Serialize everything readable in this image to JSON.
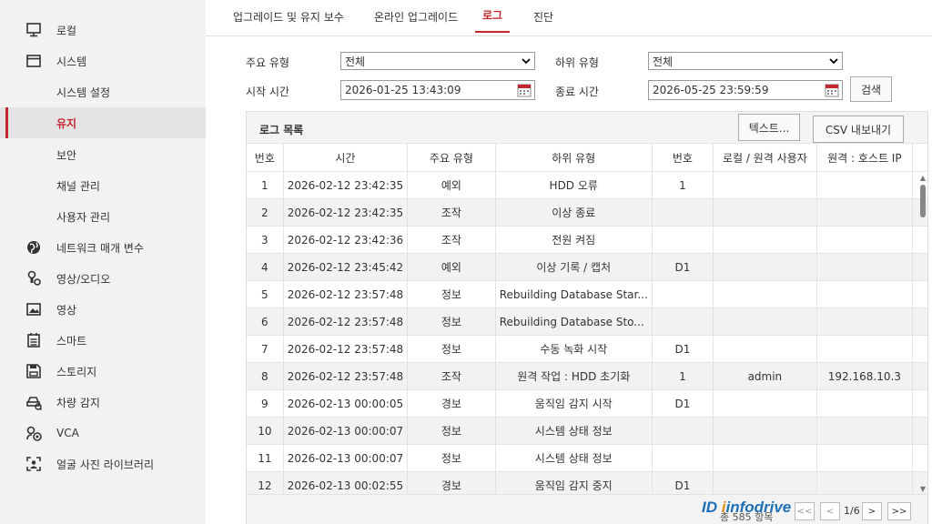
{
  "sidebar": {
    "items": [
      {
        "label": "로컬",
        "icon": "monitor-icon"
      },
      {
        "label": "시스템",
        "icon": "window-icon"
      },
      {
        "label": "시스템 설정"
      },
      {
        "label": "유지"
      },
      {
        "label": "보안"
      },
      {
        "label": "채널 관리"
      },
      {
        "label": "사용자 관리"
      },
      {
        "label": "네트워크 매개 변수",
        "icon": "globe-icon"
      },
      {
        "label": "영상/오디오",
        "icon": "video-audio-icon"
      },
      {
        "label": "영상",
        "icon": "image-icon"
      },
      {
        "label": "스마트",
        "icon": "smart-icon"
      },
      {
        "label": "스토리지",
        "icon": "storage-icon"
      },
      {
        "label": "차량 감지",
        "icon": "car-icon"
      },
      {
        "label": "VCA",
        "icon": "vca-icon"
      },
      {
        "label": "얼굴 사진 라이브러리",
        "icon": "face-icon"
      }
    ]
  },
  "tabs": [
    "업그레이드 및 유지 보수",
    "온라인 업그레이드",
    "로그",
    "진단"
  ],
  "filters": {
    "major_type_label": "주요 유형",
    "major_type_value": "전체",
    "minor_type_label": "하위 유형",
    "minor_type_value": "전체",
    "start_label": "시작 시간",
    "start_value": "2026-01-25 13:43:09",
    "end_label": "종료 시간",
    "end_value": "2026-05-25 23:59:59",
    "search_label": "검색"
  },
  "log": {
    "title": "로그 목록",
    "export_text": "텍스트...",
    "export_csv": "CSV 내보내기",
    "columns": [
      "번호",
      "시간",
      "주요 유형",
      "하위 유형",
      "번호",
      "로컬 / 원격 사용자",
      "원격 : 호스트 IP"
    ],
    "rows": [
      [
        "1",
        "2026-02-12 23:42:35",
        "예외",
        "HDD 오류",
        "1",
        "",
        ""
      ],
      [
        "2",
        "2026-02-12 23:42:35",
        "조작",
        "이상 종료",
        "",
        "",
        ""
      ],
      [
        "3",
        "2026-02-12 23:42:36",
        "조작",
        "전원 켜짐",
        "",
        "",
        ""
      ],
      [
        "4",
        "2026-02-12 23:45:42",
        "예외",
        "이상 기록 / 캡처",
        "D1",
        "",
        ""
      ],
      [
        "5",
        "2026-02-12 23:57:48",
        "정보",
        "Rebuilding Database Star...",
        "",
        "",
        ""
      ],
      [
        "6",
        "2026-02-12 23:57:48",
        "정보",
        "Rebuilding Database Sto...",
        "",
        "",
        ""
      ],
      [
        "7",
        "2026-02-12 23:57:48",
        "정보",
        "수동 녹화 시작",
        "D1",
        "",
        ""
      ],
      [
        "8",
        "2026-02-12 23:57:48",
        "조작",
        "원격 작업 : HDD 초기화",
        "1",
        "admin",
        "192.168.10.3"
      ],
      [
        "9",
        "2026-02-13 00:00:05",
        "경보",
        "움직임 감지 시작",
        "D1",
        "",
        ""
      ],
      [
        "10",
        "2026-02-13 00:00:07",
        "정보",
        "시스템 상태 정보",
        "",
        "",
        ""
      ],
      [
        "11",
        "2026-02-13 00:00:07",
        "정보",
        "시스템 상태 정보",
        "",
        "",
        ""
      ],
      [
        "12",
        "2026-02-13 00:02:55",
        "경보",
        "움직임 감지 중지",
        "D1",
        "",
        ""
      ]
    ],
    "total": "총 585 항목",
    "page": "1/6",
    "next": ">",
    "last": ">>",
    "first": "<<",
    "prev": "<"
  },
  "watermark": {
    "part1": "ID",
    "part2": "infodrive"
  },
  "colors": {
    "accent": "#c3282f",
    "sidebar_bg": "#f2f2f2"
  }
}
